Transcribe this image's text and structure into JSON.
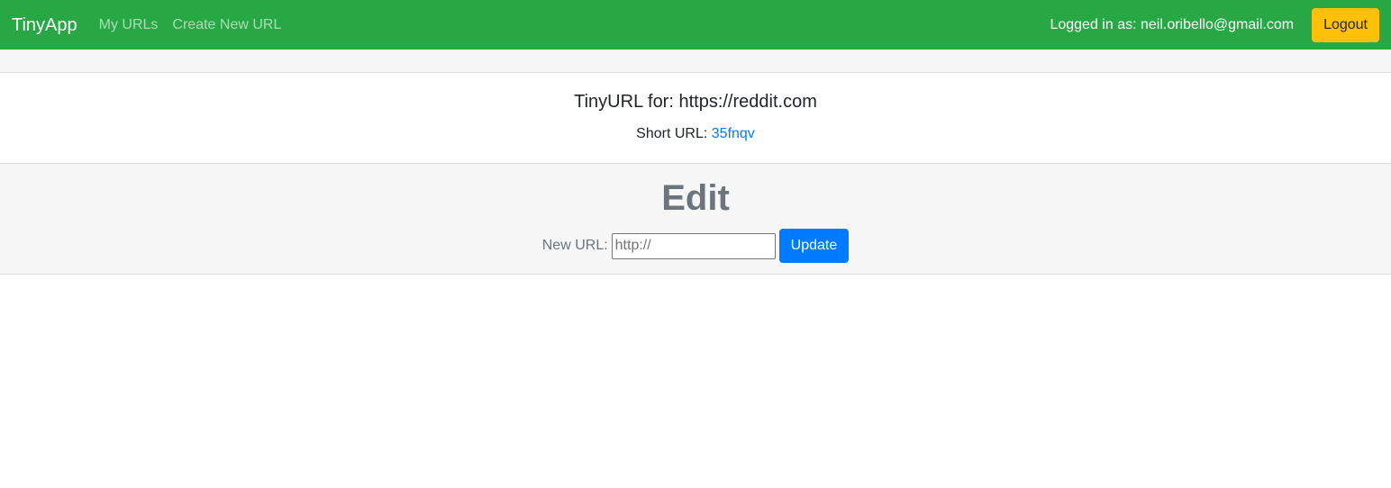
{
  "navbar": {
    "brand": "TinyApp",
    "links": [
      {
        "label": "My URLs"
      },
      {
        "label": "Create New URL"
      }
    ],
    "logged_in_text": "Logged in as: neil.oribello@gmail.com",
    "logout_label": "Logout",
    "background_color": "#28a745",
    "logout_color": "#ffc107"
  },
  "url_card": {
    "title": "TinyURL for: https://reddit.com",
    "short_url_label": "Short URL:",
    "short_url_value": "35fnqv",
    "link_color": "#007bff"
  },
  "edit_form": {
    "heading": "Edit",
    "field_label": "New URL:",
    "input_placeholder": "http://",
    "input_value": "",
    "submit_label": "Update",
    "submit_color": "#007bff"
  }
}
